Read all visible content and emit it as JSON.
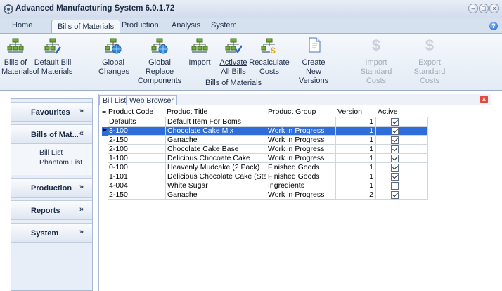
{
  "window": {
    "title": "Advanced Manufacturing System 6.0.1.72",
    "controls": [
      "–",
      "□",
      "×"
    ]
  },
  "tabs": [
    "Home",
    "Bills of Materials",
    "Production",
    "Analysis",
    "System"
  ],
  "active_tab": "Bills of Materials",
  "ribbon": {
    "buttons": [
      {
        "line1": "Bills of",
        "line2": "Materials",
        "icon": "bom-icon",
        "enabled": true
      },
      {
        "line1": "Default Bill",
        "line2": "of Materials",
        "icon": "bom-edit-icon",
        "enabled": true
      },
      {
        "line1": "Global",
        "line2": "Changes",
        "icon": "bom-globe-icon",
        "enabled": true
      },
      {
        "line1": "Global Replace",
        "line2": "Components",
        "icon": "bom-replace-icon",
        "enabled": true
      },
      {
        "line1": "Import",
        "line2": "",
        "icon": "bom-import-icon",
        "enabled": true
      },
      {
        "line1": "Activate",
        "line2": "All Bills",
        "icon": "bom-activate-icon",
        "enabled": true
      },
      {
        "line1": "Recalculate",
        "line2": "Costs",
        "icon": "bom-cost-icon",
        "enabled": true
      },
      {
        "line1": "Create New",
        "line2": "Versions",
        "icon": "document-copy-icon",
        "enabled": true
      },
      {
        "line1": "Import",
        "line2": "Standard Costs",
        "icon": "dollar-icon",
        "enabled": false
      },
      {
        "line1": "Export",
        "line2": "Standard Costs",
        "icon": "dollar-icon",
        "enabled": false
      }
    ],
    "group_label": "Bills of Materials"
  },
  "nav": {
    "sections": [
      {
        "label": "Favourites",
        "chevron": "«"
      },
      {
        "label": "Bills of Mat...",
        "chevron": "»"
      },
      {
        "label": "Production",
        "chevron": "«"
      },
      {
        "label": "Reports",
        "chevron": "«"
      },
      {
        "label": "System",
        "chevron": "«"
      }
    ],
    "bom_items": [
      "Bill List",
      "Phantom List"
    ]
  },
  "content_tabs": [
    "Bill List",
    "Web Browser"
  ],
  "grid": {
    "columns": [
      "Product Code",
      "Product Title",
      "Product Group",
      "Version",
      "Active"
    ],
    "rows": [
      {
        "code": "Defaults",
        "title": "Default Item For Boms",
        "group": "",
        "version": "1",
        "active": true,
        "selected": false
      },
      {
        "code": "3-100",
        "title": "Chocolate Cake Mix",
        "group": "Work in Progress",
        "version": "1",
        "active": true,
        "selected": true
      },
      {
        "code": "2-150",
        "title": "Ganache",
        "group": "Work in Progress",
        "version": "1",
        "active": true,
        "selected": false
      },
      {
        "code": "2-100",
        "title": "Chocolate Cake Base",
        "group": "Work in Progress",
        "version": "1",
        "active": true,
        "selected": false
      },
      {
        "code": "1-100",
        "title": "Delicious Chocoate Cake",
        "group": "Work in Progress",
        "version": "1",
        "active": true,
        "selected": false
      },
      {
        "code": "0-100",
        "title": "Heavenly Mudcake (2 Pack)",
        "group": "Finished Goods",
        "version": "1",
        "active": true,
        "selected": false
      },
      {
        "code": "1-101",
        "title": "Delicious Chocolate Cake (Staged)",
        "group": "Finished Goods",
        "version": "1",
        "active": true,
        "selected": false
      },
      {
        "code": "4-004",
        "title": "White Sugar",
        "group": "Ingredients",
        "version": "1",
        "active": false,
        "selected": false
      },
      {
        "code": "2-150",
        "title": "Ganache",
        "group": "Work in Progress",
        "version": "2",
        "active": true,
        "selected": false
      }
    ]
  }
}
